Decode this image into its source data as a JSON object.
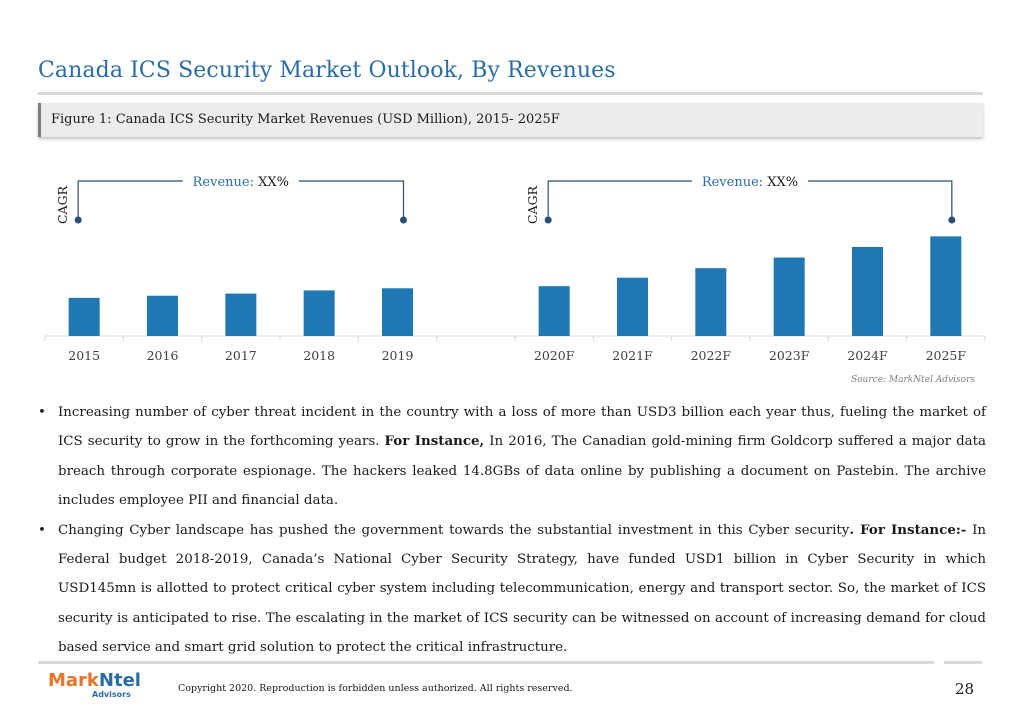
{
  "page": {
    "title": "Canada ICS Security Market Outlook, By  Revenues",
    "figure_caption": "Figure 1: Canada ICS Security Market Revenues (USD Million), 2015- 2025F",
    "source": "Source: MarkNtel Advisors",
    "copyright": "Copyright 2020. Reproduction is forbidden unless authorized. All rights reserved.",
    "page_number": "28",
    "logo": {
      "brand_a": "Mark",
      "brand_b": "Ntel",
      "sub": "Advisors"
    },
    "colors": {
      "accent": "#2a6ca8",
      "bar": "#1f77b4",
      "logo_orange": "#e8742a"
    }
  },
  "chart_data": {
    "type": "bar",
    "categories": [
      "2015",
      "2016",
      "2017",
      "2018",
      "2019",
      "",
      "2020F",
      "2021F",
      "2022F",
      "2023F",
      "2024F",
      "2025F"
    ],
    "values": [
      36,
      38,
      40,
      43,
      45,
      null,
      47,
      55,
      64,
      74,
      84,
      94
    ],
    "ylim": [
      0,
      110
    ],
    "grid": false,
    "annotations": [
      {
        "label": "CAGR",
        "text_label": "Revenue:",
        "text_value": "XX%",
        "span": [
          "2015",
          "2019"
        ]
      },
      {
        "label": "CAGR",
        "text_label": "Revenue:",
        "text_value": "XX%",
        "span": [
          "2020F",
          "2025F"
        ]
      }
    ]
  },
  "bullets": [
    {
      "pre": "Increasing number of cyber threat incident in the country with a loss of more than USD3 billion each year thus, fueling the market of ICS security to grow in the forthcoming years. ",
      "bold": "For Instance,",
      "post": " In 2016, The Canadian gold-mining firm Goldcorp suffered a major data breach through corporate espionage. The hackers leaked 14.8GBs of data online by publishing a document on Pastebin. The archive includes employee PII and financial data."
    },
    {
      "pre": "Changing Cyber landscape has pushed the government towards the substantial investment in this Cyber security",
      "bold": ". For Instance:-",
      "post": " In Federal budget 2018-2019, Canada’s National Cyber Security Strategy, have funded USD1 billion in Cyber Security in which USD145mn is allotted to protect critical cyber system including telecommunication, energy and transport sector. So, the market of ICS security is anticipated to rise. The escalating in the market of ICS security can be witnessed on account of increasing demand for cloud based service and smart grid solution to protect the critical infrastructure."
    }
  ]
}
